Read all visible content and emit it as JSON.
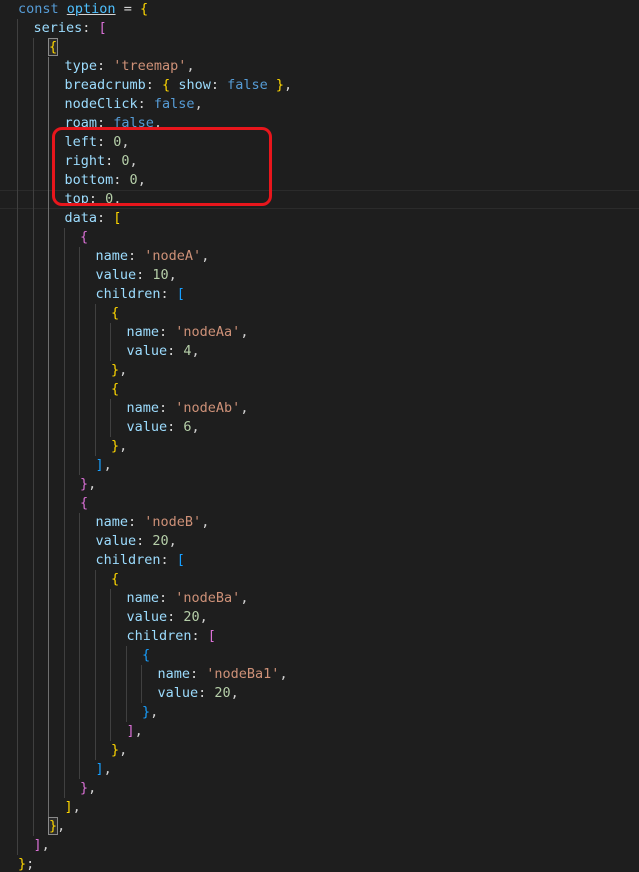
{
  "editor": {
    "language": "javascript",
    "colors": {
      "background": "#1e1e1e",
      "keyword": "#569cd6",
      "variable": "#4fc1ff",
      "property": "#9cdcfe",
      "string": "#ce9178",
      "number": "#b5cea8",
      "bracket_level_1": "#ffd700",
      "bracket_level_2": "#da70d6",
      "bracket_level_3": "#179fff",
      "annotation": "#e8161c"
    },
    "lines": [
      {
        "indent": 0,
        "tokens": [
          [
            "kw",
            "const"
          ],
          [
            "p",
            " "
          ],
          [
            "var",
            "option"
          ],
          [
            "p",
            " = "
          ],
          [
            "b1",
            "{"
          ]
        ]
      },
      {
        "indent": 1,
        "tokens": [
          [
            "prop",
            "series"
          ],
          [
            "p",
            ": "
          ],
          [
            "b2",
            "["
          ]
        ]
      },
      {
        "indent": 2,
        "tokens": [
          [
            "b3h",
            "{"
          ]
        ]
      },
      {
        "indent": 3,
        "tokens": [
          [
            "prop",
            "type"
          ],
          [
            "p",
            ": "
          ],
          [
            "str",
            "'treemap'"
          ],
          [
            "p",
            ","
          ]
        ]
      },
      {
        "indent": 3,
        "tokens": [
          [
            "prop",
            "breadcrumb"
          ],
          [
            "p",
            ": "
          ],
          [
            "b1",
            "{"
          ],
          [
            "p",
            " "
          ],
          [
            "prop",
            "show"
          ],
          [
            "p",
            ": "
          ],
          [
            "bool",
            "false"
          ],
          [
            "p",
            " "
          ],
          [
            "b1",
            "}"
          ],
          [
            "p",
            ","
          ]
        ]
      },
      {
        "indent": 3,
        "tokens": [
          [
            "prop",
            "nodeClick"
          ],
          [
            "p",
            ": "
          ],
          [
            "bool",
            "false"
          ],
          [
            "p",
            ","
          ]
        ]
      },
      {
        "indent": 3,
        "tokens": [
          [
            "prop",
            "roam"
          ],
          [
            "p",
            ": "
          ],
          [
            "bool",
            "false"
          ],
          [
            "p",
            ","
          ]
        ]
      },
      {
        "indent": 3,
        "tokens": [
          [
            "prop",
            "left"
          ],
          [
            "p",
            ": "
          ],
          [
            "num",
            "0"
          ],
          [
            "p",
            ","
          ]
        ]
      },
      {
        "indent": 3,
        "tokens": [
          [
            "prop",
            "right"
          ],
          [
            "p",
            ": "
          ],
          [
            "num",
            "0"
          ],
          [
            "p",
            ","
          ]
        ]
      },
      {
        "indent": 3,
        "tokens": [
          [
            "prop",
            "bottom"
          ],
          [
            "p",
            ": "
          ],
          [
            "num",
            "0"
          ],
          [
            "p",
            ","
          ]
        ]
      },
      {
        "indent": 3,
        "tokens": [
          [
            "prop",
            "top"
          ],
          [
            "p",
            ": "
          ],
          [
            "num",
            "0"
          ],
          [
            "p",
            ","
          ]
        ],
        "cursor": true
      },
      {
        "indent": 3,
        "tokens": [
          [
            "prop",
            "data"
          ],
          [
            "p",
            ": "
          ],
          [
            "b1",
            "["
          ]
        ]
      },
      {
        "indent": 4,
        "tokens": [
          [
            "b2",
            "{"
          ]
        ]
      },
      {
        "indent": 5,
        "tokens": [
          [
            "prop",
            "name"
          ],
          [
            "p",
            ": "
          ],
          [
            "str",
            "'nodeA'"
          ],
          [
            "p",
            ","
          ]
        ]
      },
      {
        "indent": 5,
        "tokens": [
          [
            "prop",
            "value"
          ],
          [
            "p",
            ": "
          ],
          [
            "num",
            "10"
          ],
          [
            "p",
            ","
          ]
        ]
      },
      {
        "indent": 5,
        "tokens": [
          [
            "prop",
            "children"
          ],
          [
            "p",
            ": "
          ],
          [
            "b3",
            "["
          ]
        ]
      },
      {
        "indent": 6,
        "tokens": [
          [
            "b1",
            "{"
          ]
        ]
      },
      {
        "indent": 7,
        "tokens": [
          [
            "prop",
            "name"
          ],
          [
            "p",
            ": "
          ],
          [
            "str",
            "'nodeAa'"
          ],
          [
            "p",
            ","
          ]
        ]
      },
      {
        "indent": 7,
        "tokens": [
          [
            "prop",
            "value"
          ],
          [
            "p",
            ": "
          ],
          [
            "num",
            "4"
          ],
          [
            "p",
            ","
          ]
        ]
      },
      {
        "indent": 6,
        "tokens": [
          [
            "b1",
            "}"
          ],
          [
            "p",
            ","
          ]
        ]
      },
      {
        "indent": 6,
        "tokens": [
          [
            "b1",
            "{"
          ]
        ]
      },
      {
        "indent": 7,
        "tokens": [
          [
            "prop",
            "name"
          ],
          [
            "p",
            ": "
          ],
          [
            "str",
            "'nodeAb'"
          ],
          [
            "p",
            ","
          ]
        ]
      },
      {
        "indent": 7,
        "tokens": [
          [
            "prop",
            "value"
          ],
          [
            "p",
            ": "
          ],
          [
            "num",
            "6"
          ],
          [
            "p",
            ","
          ]
        ]
      },
      {
        "indent": 6,
        "tokens": [
          [
            "b1",
            "}"
          ],
          [
            "p",
            ","
          ]
        ]
      },
      {
        "indent": 5,
        "tokens": [
          [
            "b3",
            "]"
          ],
          [
            "p",
            ","
          ]
        ]
      },
      {
        "indent": 4,
        "tokens": [
          [
            "b2",
            "}"
          ],
          [
            "p",
            ","
          ]
        ]
      },
      {
        "indent": 4,
        "tokens": [
          [
            "b2",
            "{"
          ]
        ]
      },
      {
        "indent": 5,
        "tokens": [
          [
            "prop",
            "name"
          ],
          [
            "p",
            ": "
          ],
          [
            "str",
            "'nodeB'"
          ],
          [
            "p",
            ","
          ]
        ]
      },
      {
        "indent": 5,
        "tokens": [
          [
            "prop",
            "value"
          ],
          [
            "p",
            ": "
          ],
          [
            "num",
            "20"
          ],
          [
            "p",
            ","
          ]
        ]
      },
      {
        "indent": 5,
        "tokens": [
          [
            "prop",
            "children"
          ],
          [
            "p",
            ": "
          ],
          [
            "b3",
            "["
          ]
        ]
      },
      {
        "indent": 6,
        "tokens": [
          [
            "b1",
            "{"
          ]
        ]
      },
      {
        "indent": 7,
        "tokens": [
          [
            "prop",
            "name"
          ],
          [
            "p",
            ": "
          ],
          [
            "str",
            "'nodeBa'"
          ],
          [
            "p",
            ","
          ]
        ]
      },
      {
        "indent": 7,
        "tokens": [
          [
            "prop",
            "value"
          ],
          [
            "p",
            ": "
          ],
          [
            "num",
            "20"
          ],
          [
            "p",
            ","
          ]
        ]
      },
      {
        "indent": 7,
        "tokens": [
          [
            "prop",
            "children"
          ],
          [
            "p",
            ": "
          ],
          [
            "b2",
            "["
          ]
        ]
      },
      {
        "indent": 8,
        "tokens": [
          [
            "b3",
            "{"
          ]
        ]
      },
      {
        "indent": 9,
        "tokens": [
          [
            "prop",
            "name"
          ],
          [
            "p",
            ": "
          ],
          [
            "str",
            "'nodeBa1'"
          ],
          [
            "p",
            ","
          ]
        ]
      },
      {
        "indent": 9,
        "tokens": [
          [
            "prop",
            "value"
          ],
          [
            "p",
            ": "
          ],
          [
            "num",
            "20"
          ],
          [
            "p",
            ","
          ]
        ]
      },
      {
        "indent": 8,
        "tokens": [
          [
            "b3",
            "}"
          ],
          [
            "p",
            ","
          ]
        ]
      },
      {
        "indent": 7,
        "tokens": [
          [
            "b2",
            "]"
          ],
          [
            "p",
            ","
          ]
        ]
      },
      {
        "indent": 6,
        "tokens": [
          [
            "b1",
            "}"
          ],
          [
            "p",
            ","
          ]
        ]
      },
      {
        "indent": 5,
        "tokens": [
          [
            "b3",
            "]"
          ],
          [
            "p",
            ","
          ]
        ]
      },
      {
        "indent": 4,
        "tokens": [
          [
            "b2",
            "}"
          ],
          [
            "p",
            ","
          ]
        ]
      },
      {
        "indent": 3,
        "tokens": [
          [
            "b1",
            "]"
          ],
          [
            "p",
            ","
          ]
        ]
      },
      {
        "indent": 2,
        "tokens": [
          [
            "b3h",
            "}"
          ],
          [
            "p",
            ","
          ]
        ]
      },
      {
        "indent": 1,
        "tokens": [
          [
            "b2",
            "]"
          ],
          [
            "p",
            ","
          ]
        ]
      },
      {
        "indent": 0,
        "tokens": [
          [
            "b1",
            "}"
          ],
          [
            "p",
            ";"
          ]
        ]
      }
    ]
  }
}
